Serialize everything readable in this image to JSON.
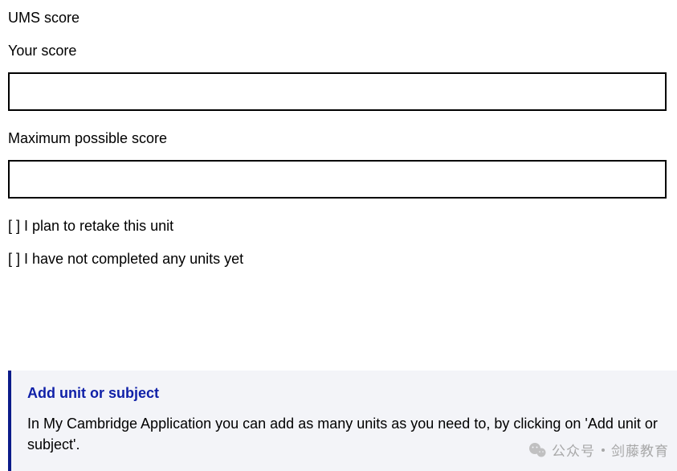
{
  "heading": "UMS score",
  "fields": {
    "your_score": {
      "label": "Your score",
      "value": ""
    },
    "max_score": {
      "label": "Maximum possible score",
      "value": ""
    }
  },
  "checkboxes": {
    "retake": "[  ] I plan to retake this unit",
    "not_completed": "[  ] I have not completed any units yet"
  },
  "info": {
    "heading": "Add unit or subject",
    "body": "In My Cambridge Application you can add as many units as you need to, by clicking on 'Add unit or subject'."
  },
  "watermark": {
    "label1": "公众号",
    "label2": "剑藤教育"
  }
}
